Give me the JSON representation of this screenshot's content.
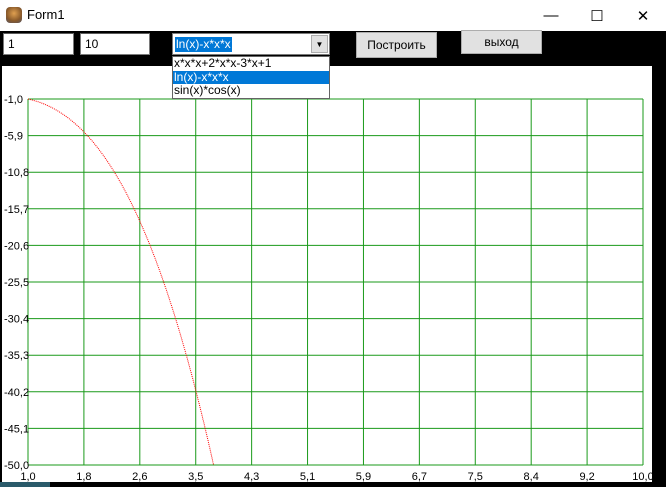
{
  "window": {
    "title": "Form1",
    "minimize": "—",
    "maximize": "☐",
    "close": "✕"
  },
  "toolbar": {
    "x_from": "1",
    "x_to": "10",
    "function_selected": "ln(x)-x*x*x",
    "function_options": [
      "x*x*x+2*x*x-3*x+1",
      "ln(x)-x*x*x",
      "sin(x)*cos(x)"
    ],
    "build_label": "Построить",
    "exit_label": "выход"
  },
  "colors": {
    "grid": "#1a9a1a",
    "curve": "#ff0000",
    "selection": "#0078d7"
  },
  "chart_data": {
    "type": "line",
    "function": "ln(x)-x*x*x",
    "xlim": [
      1,
      10
    ],
    "ylim": [
      -50,
      -1
    ],
    "x_ticks": [
      "1,0",
      "1,8",
      "2,6",
      "3,5",
      "4,3",
      "5,1",
      "5,9",
      "6,7",
      "7,5",
      "8,4",
      "9,2",
      "10,0"
    ],
    "y_ticks": [
      "-1,0",
      "-5,9",
      "-10,8",
      "-15,7",
      "-20,6",
      "-25,5",
      "-30,4",
      "-35,3",
      "-40,2",
      "-45,1",
      "-50,0"
    ],
    "grid": true
  }
}
